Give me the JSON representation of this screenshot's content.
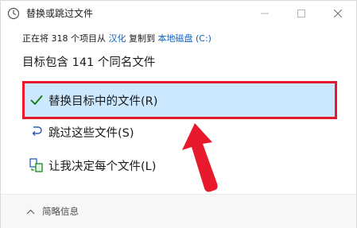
{
  "window": {
    "title": "替换或跳过文件",
    "icons": {
      "app": "copy-dialog-icon",
      "minimize": "minimize-icon",
      "maximize": "maximize-icon",
      "close": "close-icon"
    }
  },
  "info": {
    "prefix": "正在将 318 个项目从",
    "source": "汉化",
    "middle": "复制到",
    "destination": "本地磁盘 (C:)"
  },
  "heading": "目标包含 141 个同名文件",
  "options": [
    {
      "label": "替换目标中的文件(R)",
      "icon": "checkmark-icon",
      "selected": true
    },
    {
      "label": "跳过这些文件(S)",
      "icon": "skip-arrow-icon",
      "selected": false
    },
    {
      "label": "让我决定每个文件(L)",
      "icon": "compare-files-icon",
      "selected": false
    }
  ],
  "footer": {
    "details_label": "简略信息",
    "icon": "chevron-up-icon"
  },
  "colors": {
    "link": "#0b61c4",
    "selection": "#cce8ff",
    "annotation": "#e8192c",
    "accent_green": "#0f7b0f"
  }
}
